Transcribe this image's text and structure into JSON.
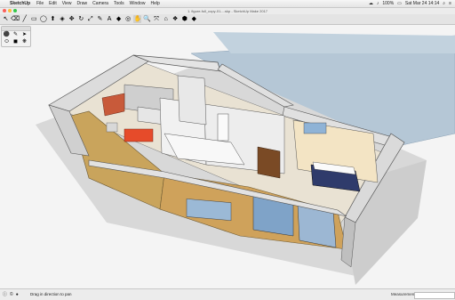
{
  "menubar": {
    "apple_glyph": "",
    "app": "SketchUp",
    "items": [
      "File",
      "Edit",
      "View",
      "Draw",
      "Camera",
      "Tools",
      "Window",
      "Help"
    ],
    "battery": "100%",
    "datetime": "Sat Mar 24 14:14"
  },
  "window": {
    "title": "1. figure-full_copy-01-...skp - SketchUp Make 2017"
  },
  "toolbar": {
    "tools": [
      {
        "name": "select-tool",
        "glyph": "↖"
      },
      {
        "name": "eraser-tool",
        "glyph": "⌫"
      },
      {
        "name": "line-tool",
        "glyph": "╱"
      },
      {
        "name": "rectangle-tool",
        "glyph": "▭"
      },
      {
        "name": "circle-tool",
        "glyph": "◯"
      },
      {
        "name": "pushpull-tool",
        "glyph": "⬆"
      },
      {
        "name": "offset-tool",
        "glyph": "◈"
      },
      {
        "name": "move-tool",
        "glyph": "✥"
      },
      {
        "name": "rotate-tool",
        "glyph": "↻"
      },
      {
        "name": "scale-tool",
        "glyph": "⤢"
      },
      {
        "name": "tape-tool",
        "glyph": "✎"
      },
      {
        "name": "text-tool",
        "glyph": "A"
      },
      {
        "name": "paint-tool",
        "glyph": "◆"
      },
      {
        "name": "orbit-tool",
        "glyph": "◎"
      },
      {
        "name": "pan-tool",
        "glyph": "✋"
      },
      {
        "name": "zoom-tool",
        "glyph": "🔍"
      },
      {
        "name": "zoom-extents-tool",
        "glyph": "⤧"
      },
      {
        "name": "warehouse-tool",
        "glyph": "⌂"
      },
      {
        "name": "components-tool",
        "glyph": "❖"
      },
      {
        "name": "extension-tool",
        "glyph": "⬢"
      },
      {
        "name": "ruby-tool",
        "glyph": "◆"
      }
    ],
    "selected_index": 14
  },
  "palette": {
    "items": [
      "⚫",
      "✎",
      "➤",
      "⬭",
      "◼",
      "❋"
    ]
  },
  "status": {
    "hint": "Drag in direction to pan",
    "measurements_label": "Measurements"
  }
}
